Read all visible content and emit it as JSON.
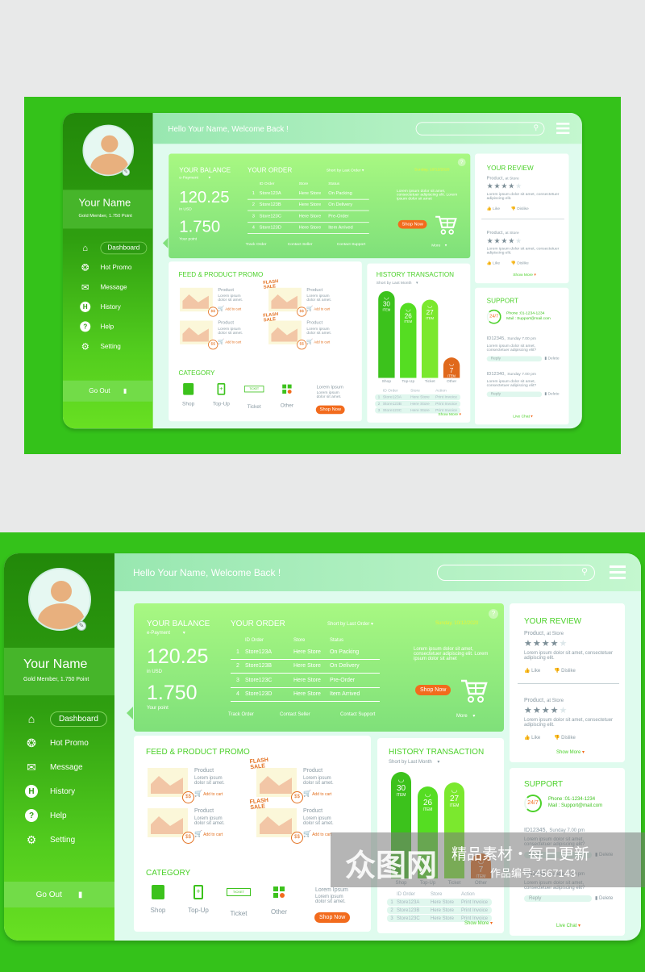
{
  "header": {
    "greeting": "Hello Your Name, Welcome Back !",
    "search_placeholder": ""
  },
  "profile": {
    "name": "Your Name",
    "member": "Gold Member, 1.750 Point"
  },
  "sidebar": {
    "items": [
      {
        "label": "Dashboard",
        "icon": "home-icon",
        "active": true
      },
      {
        "label": "Hot Promo",
        "icon": "promo-tag-icon"
      },
      {
        "label": "Message",
        "icon": "envelope-icon"
      },
      {
        "label": "History",
        "icon": "history-icon"
      },
      {
        "label": "Help",
        "icon": "help-icon"
      },
      {
        "label": "Setting",
        "icon": "gear-icon"
      }
    ],
    "go_out": "Go Out"
  },
  "balance": {
    "title": "YOUR BALANCE",
    "method": "e-Payment",
    "amount": "120.25",
    "amount_unit": "in USD",
    "points": "1.750",
    "points_label": "Your point"
  },
  "order": {
    "title": "YOUR ORDER",
    "sort": "Short by Last Order",
    "date": "Sunday, 10/12/2020",
    "columns": [
      "ID Order",
      "Store",
      "Status"
    ],
    "rows": [
      [
        "1",
        "Store123A",
        "Here Store",
        "On Packing"
      ],
      [
        "2",
        "Store123B",
        "Here Store",
        "On Delivery"
      ],
      [
        "3",
        "Store123C",
        "Here Store",
        "Pre-Order"
      ],
      [
        "4",
        "Store123D",
        "Here Store",
        "Item Arrived"
      ]
    ],
    "links": [
      "Track Order",
      "Contact Seller",
      "Contact Support"
    ],
    "promo_text": "Lorem ipsum dolor sit amet, consectetuer adipiscing elit. Lorem ipsum dolor sit  amet",
    "shop_now": "Shop Now",
    "more": "More",
    "help": "?"
  },
  "review": {
    "title": "YOUR REVIEW",
    "items": [
      {
        "product": "Product,",
        "store": "at Store",
        "rating": 4,
        "text": "Lorem ipsum dolor sit amet, consectetuer adipiscing elit.",
        "like": "Like",
        "dislike": "Dislike"
      },
      {
        "product": "Product,",
        "store": "at Store",
        "rating": 4,
        "text": "Lorem ipsum dolor sit amet, consectetuer adipiscing elit.",
        "like": "Like",
        "dislike": "Dislike"
      }
    ],
    "show_more": "Show More"
  },
  "support": {
    "title": "SUPPORT",
    "badge": "24/7",
    "phone": "Phone :01-1234-1234",
    "mail": "Mail    : Support@mail.com",
    "tickets": [
      {
        "id": "ID12345,",
        "time": "Sunday 7.00 pm",
        "text": "Lorem ipsum dolor sit amet, consectetuer adipiscing elit?",
        "reply": "Reply",
        "delete": "Delete"
      },
      {
        "id": "ID12340,",
        "time": "Sunday 7.00 pm",
        "text": "Lorem ipsum dolor sit amet, consectetuer adipiscing elit?",
        "reply": "Reply",
        "delete": "Delete"
      }
    ],
    "live_chat": "Live Chat"
  },
  "feed": {
    "title": "FEED & PRODUCT PROMO",
    "products": [
      {
        "name": "Product",
        "desc": "Lorem ipsum dolor sit amet.",
        "cart": "Add to cart",
        "price": "$$",
        "flash": false
      },
      {
        "name": "Product",
        "desc": "Lorem ipsum dolor sit amet.",
        "cart": "Add to cart",
        "price": "$$",
        "flash": true
      },
      {
        "name": "Product",
        "desc": "Lorem ipsum dolor sit amet.",
        "cart": "Add to cart",
        "price": "$$",
        "flash": false
      },
      {
        "name": "Product",
        "desc": "Lorem ipsum dolor sit amet.",
        "cart": "Add to cart",
        "price": "$$",
        "flash": true
      }
    ],
    "flash_label": "FLASH SALE"
  },
  "category": {
    "title": "CATEGORY",
    "items": [
      "Shop",
      "Top-Up",
      "Ticket",
      "Other"
    ],
    "ticket_text": "TICKET",
    "promo_title": "Lorem Ipsum",
    "promo_text": "Lorem ipsum dolor sit amet.",
    "shop_now": "Shop Now"
  },
  "history": {
    "title": "HISTORY TRANSACTION",
    "sort": "Short by Last Month",
    "unit": "ITEM",
    "chart_data": {
      "type": "bar",
      "categories": [
        "Shop",
        "Top-Up",
        "Ticket",
        "Other"
      ],
      "values": [
        30,
        26,
        27,
        7
      ],
      "colors": [
        "#3cc21c",
        "#55dd22",
        "#7be82e",
        "#e0691c"
      ]
    },
    "columns": [
      "ID Order",
      "Store",
      "Action"
    ],
    "rows": [
      [
        "1",
        "Store123A",
        "Here Store",
        "Print Invoice"
      ],
      [
        "2",
        "Store123B",
        "Here Store",
        "Print Invoice"
      ],
      [
        "3",
        "Store123C",
        "Here Store",
        "Print Invoice"
      ]
    ],
    "show_more": "Show More"
  },
  "watermark": {
    "logo": "众图网",
    "line1": "精品素材・每日更新",
    "line2": "作品编号:4567143"
  }
}
